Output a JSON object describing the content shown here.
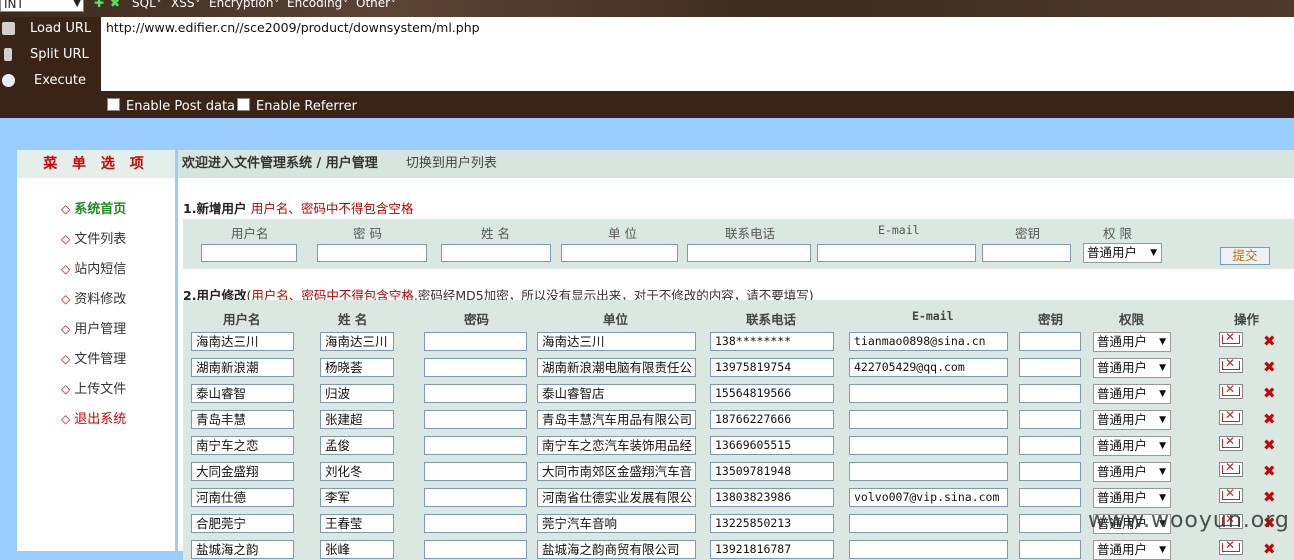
{
  "hackbar": {
    "select_value": "INT",
    "menus": [
      "SQL",
      "XSS",
      "Encryption",
      "Encoding",
      "Other"
    ],
    "actions": [
      {
        "label": "Load URL",
        "icon": "load-url-icon"
      },
      {
        "label": "Split URL",
        "icon": "split-url-icon"
      },
      {
        "label": "Execute",
        "icon": "execute-icon"
      }
    ],
    "url": "http://www.edifier.cn//sce2009/product/downsystem/ml.php",
    "enable_post": "Enable Post data",
    "enable_referrer": "Enable Referrer"
  },
  "sidebar": {
    "title": "菜 单 选 项",
    "items": [
      "系统首页",
      "文件列表",
      "站内短信",
      "资料修改",
      "用户管理",
      "文件管理",
      "上传文件",
      "退出系统"
    ]
  },
  "main": {
    "title": "欢迎进入文件管理系统 / 用户管理",
    "switch_link": "切换到用户列表",
    "add_section": {
      "title": "1.新增用户",
      "warning": "用户名、密码中不得包含空格",
      "headers": [
        "用户名",
        "密 码",
        "姓 名",
        "单 位",
        "联系电话",
        "E-mail",
        "密钥",
        "权 限"
      ],
      "role_value": "普通用户",
      "submit": "提交"
    },
    "edit_section": {
      "title": "2.用户修改",
      "paren_open": "(",
      "warning": "用户名、密码中不得包含空格",
      "note": ",密码经MD5加密，所以没有显示出来，对于不修改的内容，请不要填写)",
      "headers": [
        "用户名",
        "姓 名",
        "密码",
        "单位",
        "联系电话",
        "E-mail",
        "密钥",
        "权限",
        "操作"
      ],
      "rows": [
        {
          "username": "海南达三川",
          "name": "海南达三川",
          "unit": "海南达三川",
          "phone": "138********",
          "email": "tianmao0898@sina.cn",
          "role": "普通用户"
        },
        {
          "username": "湖南新浪潮",
          "name": "杨晓荟",
          "unit": "湖南新浪潮电脑有限责任公",
          "phone": "13975819754",
          "email": "422705429@qq.com",
          "role": "普通用户"
        },
        {
          "username": "泰山睿智",
          "name": "归波",
          "unit": "泰山睿智店",
          "phone": "15564819566",
          "email": "",
          "role": "普通用户"
        },
        {
          "username": "青岛丰慧",
          "name": "张建超",
          "unit": "青岛丰慧汽车用品有限公司",
          "phone": "18766227666",
          "email": "",
          "role": "普通用户"
        },
        {
          "username": "南宁车之恋",
          "name": "孟俊",
          "unit": "南宁车之恋汽车装饰用品经",
          "phone": "13669605515",
          "email": "",
          "role": "普通用户"
        },
        {
          "username": "大同金盛翔",
          "name": "刘化冬",
          "unit": "大同市南郊区金盛翔汽车音",
          "phone": "13509781948",
          "email": "",
          "role": "普通用户"
        },
        {
          "username": "河南仕德",
          "name": "李军",
          "unit": "河南省仕德实业发展有限公",
          "phone": "13803823986",
          "email": "volvo007@vip.sina.com",
          "role": "普通用户"
        },
        {
          "username": "合肥莞宁",
          "name": "王春莹",
          "unit": "莞宁汽车音响",
          "phone": "13225850213",
          "email": "",
          "role": "普通用户"
        },
        {
          "username": "盐城海之韵",
          "name": "张峰",
          "unit": "盐城海之韵商贸有限公司",
          "phone": "13921816787",
          "email": "",
          "role": "普通用户"
        }
      ]
    }
  },
  "watermark": "www.wooyun.org"
}
